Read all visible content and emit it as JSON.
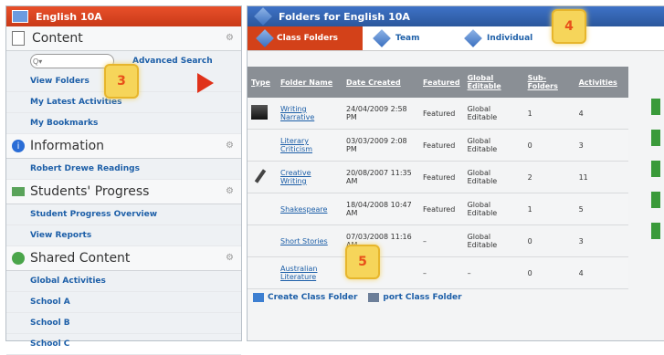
{
  "left": {
    "title": "English 10A",
    "sections": [
      {
        "name": "content",
        "label": "Content"
      },
      {
        "name": "information",
        "label": "Information"
      },
      {
        "name": "students-progress",
        "label": "Students' Progress"
      },
      {
        "name": "shared-content",
        "label": "Shared Content"
      }
    ],
    "search": {
      "placeholder": "Q▾",
      "advanced": "Advanced Search"
    },
    "content_links": [
      "View Folders",
      "My Latest Activities",
      "My Bookmarks"
    ],
    "information_links": [
      "Robert Drewe Readings"
    ],
    "progress_links": [
      "Student Progress Overview",
      "View Reports"
    ],
    "shared_links": [
      "Global Activities",
      "School A",
      "School B",
      "School C"
    ]
  },
  "right": {
    "title": "Folders for English 10A",
    "tabs": [
      "Class Folders",
      "Team",
      "Individual"
    ],
    "columns": [
      "Type",
      "Folder Name",
      "Date Created",
      "Featured",
      "Global Editable",
      "Sub-Folders",
      "Activities"
    ],
    "rows": [
      {
        "name": "Writing Narrative",
        "date": "24/04/2009 2:58 PM",
        "featured": "Featured",
        "global": "Global Editable",
        "sub": "1",
        "acts": "4"
      },
      {
        "name": "Literary Criticism",
        "date": "03/03/2009 2:08 PM",
        "featured": "Featured",
        "global": "Global Editable",
        "sub": "0",
        "acts": "3"
      },
      {
        "name": "Creative Writing",
        "date": "20/08/2007 11:35 AM",
        "featured": "Featured",
        "global": "Global Editable",
        "sub": "2",
        "acts": "11"
      },
      {
        "name": "Shakespeare",
        "date": "18/04/2008 10:47 AM",
        "featured": "Featured",
        "global": "Global Editable",
        "sub": "1",
        "acts": "5"
      },
      {
        "name": "Short Stories",
        "date": "07/03/2008 11:16 AM",
        "featured": "–",
        "global": "Global Editable",
        "sub": "0",
        "acts": "3"
      },
      {
        "name": "Australian Literature",
        "date": ":44 PM",
        "featured": "–",
        "global": "–",
        "sub": "0",
        "acts": "4"
      }
    ],
    "footer": {
      "create": "Create Class Folder",
      "export": "port Class Folder"
    }
  },
  "callouts": [
    "3",
    "4",
    "5"
  ]
}
